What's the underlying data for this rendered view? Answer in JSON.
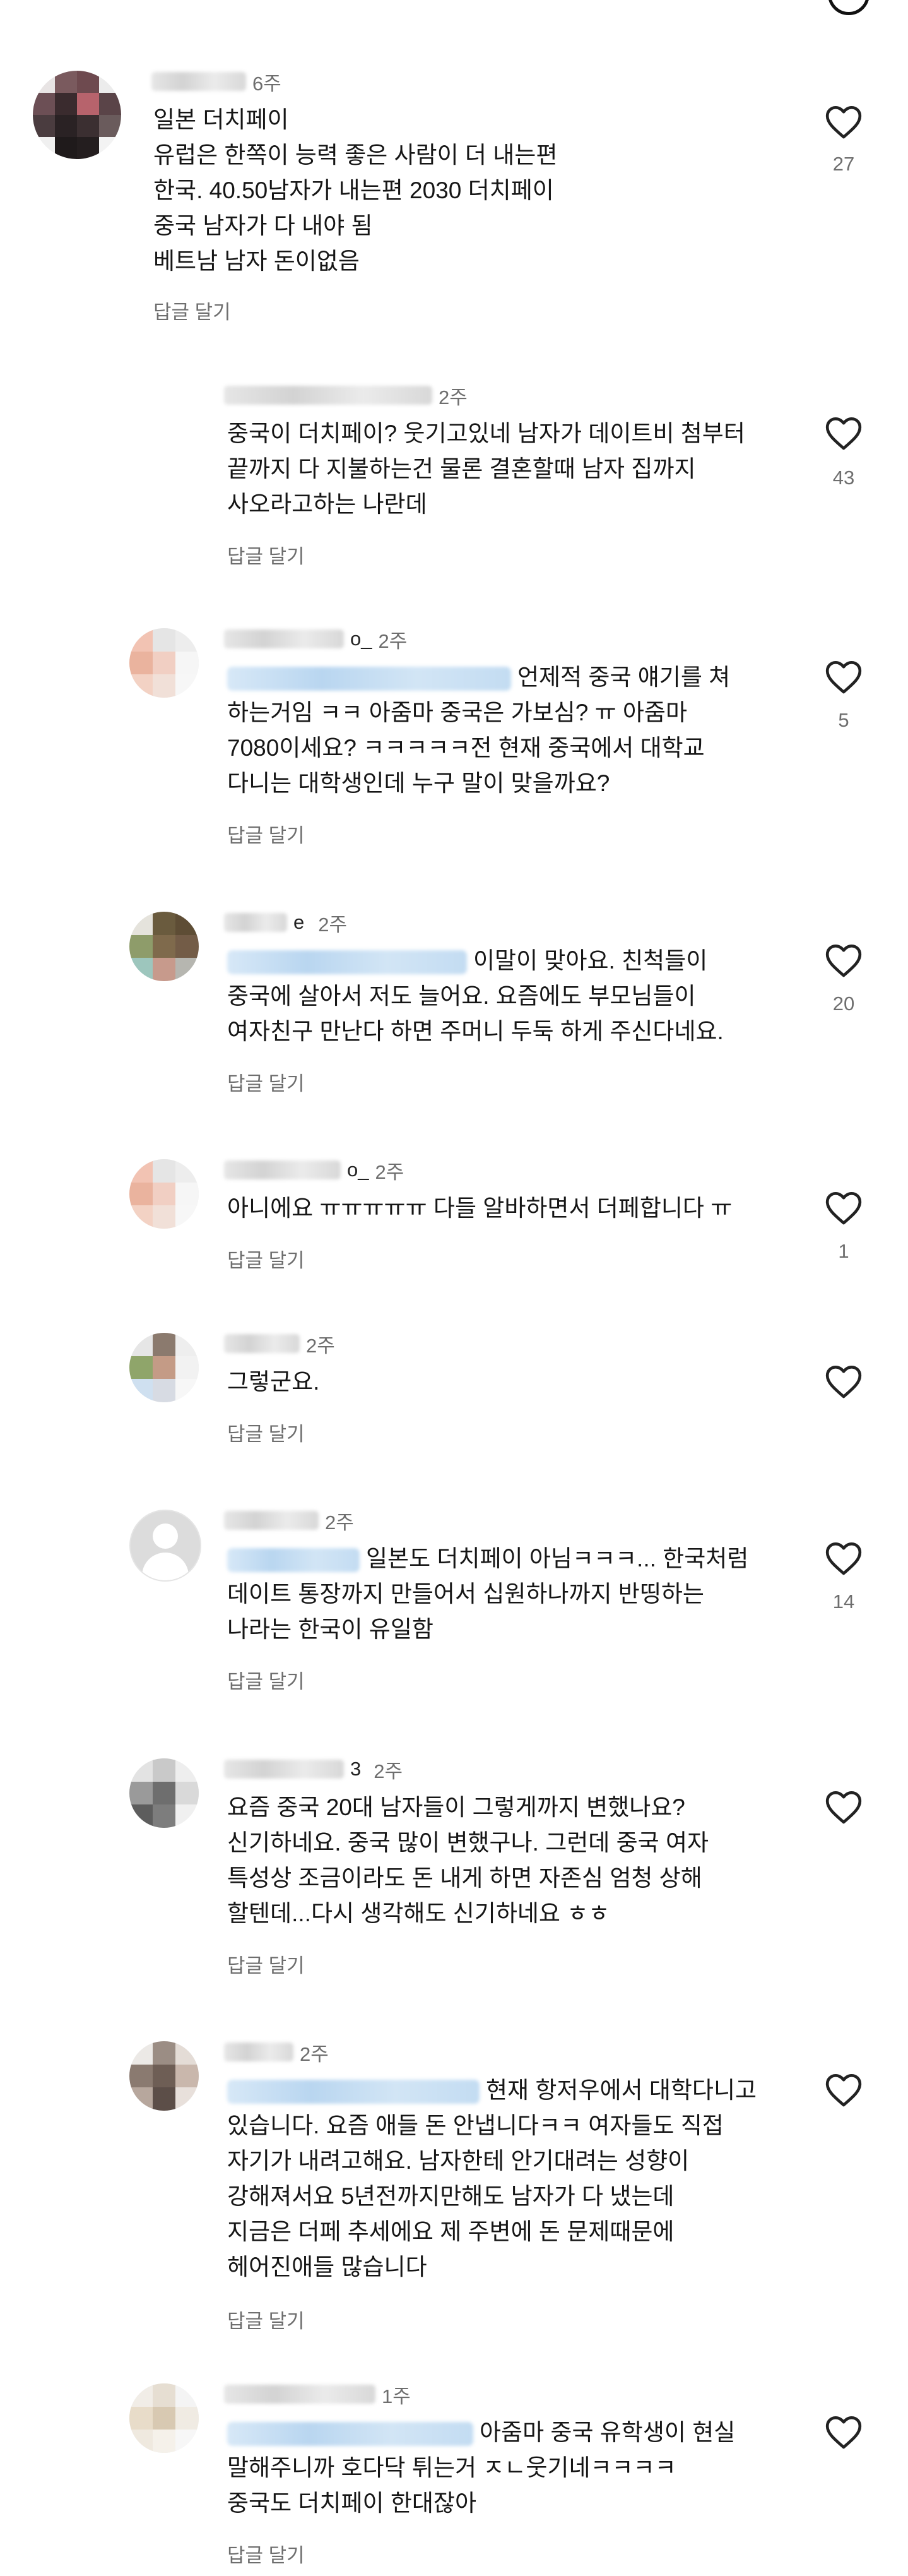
{
  "palette": {
    "text": "#161616",
    "muted": "#6e6e6e",
    "mention_blur": "#b9d6f0"
  },
  "comments": [
    {
      "id": "c1",
      "time": "6주",
      "lines": [
        "일본 더치페이",
        "유럽은 한쪽이 능력 좋은 사람이 더 내는편",
        "한국. 40.50남자가 내는편 2030 더치페이",
        "중국 남자가 다 내야 됨",
        "베트남 남자 돈이없음"
      ],
      "reply_label": "답글 달기",
      "likes": "27"
    },
    {
      "id": "c2",
      "time": "2주",
      "lines": [
        "중국이 더치페이? 웃기고있네 남자가 데이트비 첨부터",
        "끝까지 다 지불하는건 물론 결혼할때 남자 집까지",
        "사오라고하는 나란데"
      ],
      "reply_label": "답글 달기",
      "likes": "43"
    },
    {
      "id": "c3",
      "time": "2주",
      "name_suffix": "o_",
      "lines": [
        "언제적 중국 얘기를 쳐",
        "하는거임 ㅋㅋ 아줌마 중국은 가보심? ㅠ 아줌마",
        "7080이세요? ㅋㅋㅋㅋㅋ전 현재 중국에서 대학교",
        "다니는 대학생인데 누구 말이 맞을까요?"
      ],
      "reply_label": "답글 달기",
      "likes": "5"
    },
    {
      "id": "c4",
      "time": "2주",
      "name_suffix": "e",
      "lines": [
        "이말이 맞아요. 친척들이",
        "중국에 살아서 저도 늘어요. 요즘에도 부모님들이",
        "여자친구 만난다 하면 주머니 두둑 하게 주신다네요."
      ],
      "reply_label": "답글 달기",
      "likes": "20"
    },
    {
      "id": "c5",
      "time": "2주",
      "name_suffix": "o_",
      "lines": [
        "아니에요 ㅠㅠㅠㅠㅠ 다들 알바하면서 더페합니다 ㅠ"
      ],
      "reply_label": "답글 달기",
      "likes": "1"
    },
    {
      "id": "c6",
      "time": "2주",
      "lines": [
        "그렇군요."
      ],
      "reply_label": "답글 달기",
      "likes": ""
    },
    {
      "id": "c7",
      "time": "2주",
      "lines": [
        "일본도 더치페이 아님ㅋㅋㅋ... 한국처럼",
        "데이트 통장까지 만들어서 십원하나까지 반띵하는",
        "나라는 한국이 유일함"
      ],
      "reply_label": "답글 달기",
      "likes": "14"
    },
    {
      "id": "c8",
      "time": "2주",
      "name_suffix": "3",
      "lines": [
        "요즘 중국 20대 남자들이 그렇게까지 변했나요?",
        "신기하네요. 중국 많이 변했구나. 그런데 중국 여자",
        "특성상 조금이라도 돈 내게 하면 자존심 엄청 상해",
        "할텐데...다시 생각해도 신기하네요 ㅎㅎ"
      ],
      "reply_label": "답글 달기",
      "likes": ""
    },
    {
      "id": "c9",
      "time": "2주",
      "lines": [
        "현재 항저우에서 대학다니고",
        "있습니다. 요즘 애들 돈 안냅니다ㅋㅋ 여자들도 직접",
        "자기가 내려고해요. 남자한테 안기대려는 성향이",
        "강해져서요 5년전까지만해도 남자가 다 냈는데",
        "지금은 더페 추세에요 제 주변에 돈 문제때문에",
        "헤어진애들 많습니다"
      ],
      "reply_label": "답글 달기",
      "likes": ""
    },
    {
      "id": "c10",
      "time": "1주",
      "lines": [
        "아줌마 중국 유학생이 현실",
        "말해주니까 호다닥 튀는거 ㅈㄴ웃기네ㅋㅋㅋㅋ",
        "중국도 더치페이 한대잖아"
      ],
      "reply_label": "답글 달기",
      "likes": ""
    }
  ]
}
